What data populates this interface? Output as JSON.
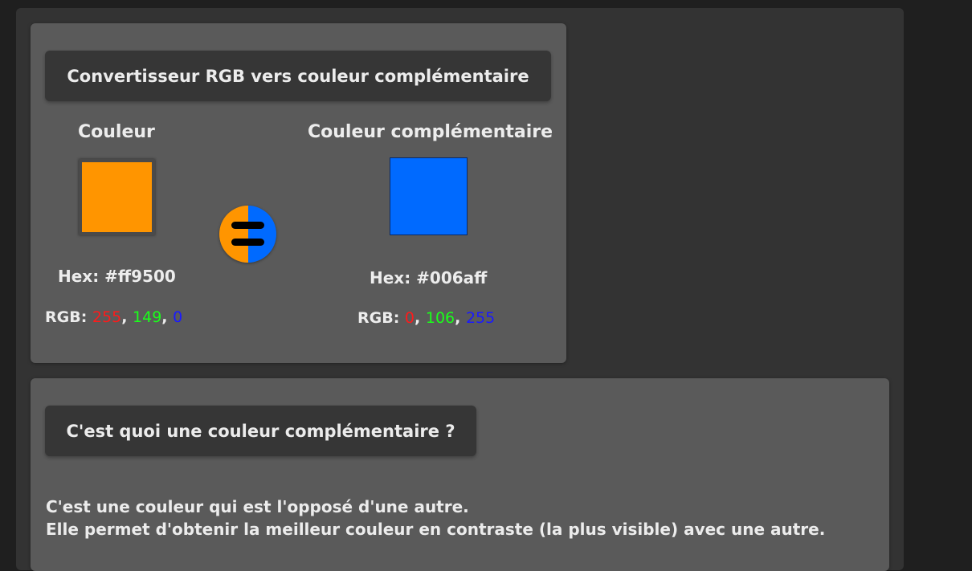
{
  "converter": {
    "title": "Convertisseur RGB vers couleur complémentaire",
    "source": {
      "heading": "Couleur",
      "hex_label": "Hex: #ff9500",
      "swatch_color": "#ff9500",
      "rgb_prefix": "RGB: ",
      "r": "255",
      "g": "149",
      "b": "0",
      "sep": ", "
    },
    "complement": {
      "heading": "Couleur complémentaire",
      "hex_label": "Hex: #006aff",
      "swatch_color": "#006aff",
      "rgb_prefix": "RGB: ",
      "r": "0",
      "g": "106",
      "b": "255",
      "sep": ", "
    },
    "swap_icon": "equals-icon"
  },
  "info": {
    "title": "C'est quoi une couleur complémentaire ?",
    "line1": "C'est une couleur qui est l'opposé d'une autre.",
    "line2": "Elle permet d'obtenir la meilleur couleur en contraste (la plus visible) avec une autre."
  },
  "colors": {
    "red": "#ff1a1a",
    "green": "#1aff1a",
    "blue": "#1a1aff",
    "swap_left": "#ff9500",
    "swap_right": "#006aff"
  }
}
